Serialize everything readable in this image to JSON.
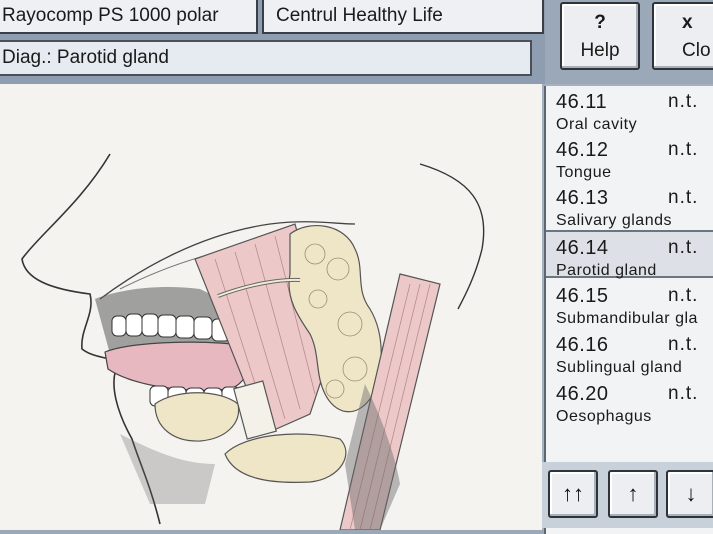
{
  "header": {
    "device_tab": "Rayocomp PS 1000 polar",
    "company_tab": "Centrul Healthy Life",
    "diagnosis": "Diag.: Parotid gland"
  },
  "buttons": {
    "help_glyph": "?",
    "help_label": "Help",
    "close_glyph": "x",
    "close_label": "Clo"
  },
  "list": {
    "items": [
      {
        "code": "46.11",
        "status": "n.t.",
        "name": "Oral cavity",
        "selected": false
      },
      {
        "code": "46.12",
        "status": "n.t.",
        "name": "Tongue",
        "selected": false
      },
      {
        "code": "46.13",
        "status": "n.t.",
        "name": "Salivary glands",
        "selected": false
      },
      {
        "code": "46.14",
        "status": "n.t.",
        "name": "Parotid gland",
        "selected": true
      },
      {
        "code": "46.15",
        "status": "n.t.",
        "name": "Submandibular gla",
        "selected": false
      },
      {
        "code": "46.16",
        "status": "n.t.",
        "name": "Sublingual gland",
        "selected": false
      },
      {
        "code": "46.20",
        "status": "n.t.",
        "name": "Oesophagus",
        "selected": false
      }
    ]
  },
  "nav": {
    "first_glyph": "↑↑",
    "up_glyph": "↑",
    "down_glyph": "↓"
  },
  "illustration": {
    "icon": "anatomy-head-parotid-illustration"
  }
}
